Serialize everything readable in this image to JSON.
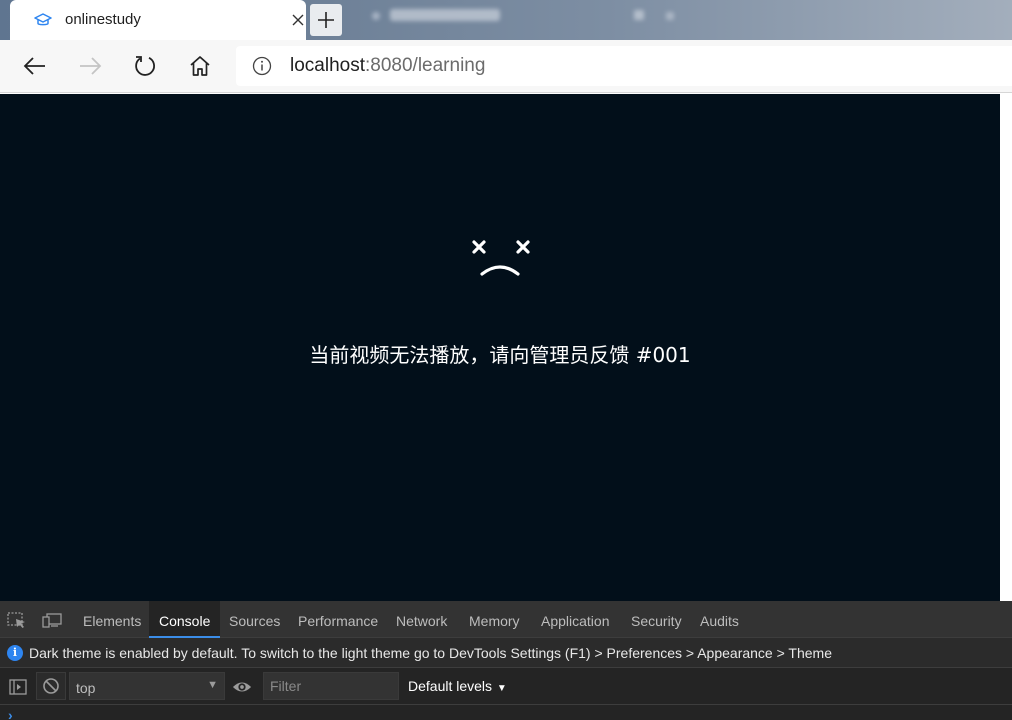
{
  "browser": {
    "tab": {
      "title": "onlinestudy",
      "favicon": "graduation-cap-icon",
      "close": "close-icon"
    },
    "new_tab": "plus-icon",
    "toolbar": {
      "back": "back-arrow-icon",
      "forward": "forward-arrow-icon",
      "refresh": "refresh-icon",
      "home": "home-icon"
    },
    "address": {
      "host": "localhost",
      "rest": ":8080/learning",
      "info_icon": "info-icon"
    }
  },
  "video": {
    "icon": "sad-face-icon",
    "message": "当前视频无法播放，请向管理员反馈 #001",
    "background": "#020f1a"
  },
  "devtools": {
    "tabs": [
      "Elements",
      "Console",
      "Sources",
      "Performance",
      "Network",
      "Memory",
      "Application",
      "Security",
      "Audits"
    ],
    "active_tab": "Console",
    "banner": "Dark theme is enabled by default. To switch to the light theme go to DevTools Settings (F1) > Preferences > Appearance > Theme",
    "context": "top",
    "filter_placeholder": "Filter",
    "levels": "Default levels",
    "prompt": "›",
    "accent": "#3b8de8"
  }
}
